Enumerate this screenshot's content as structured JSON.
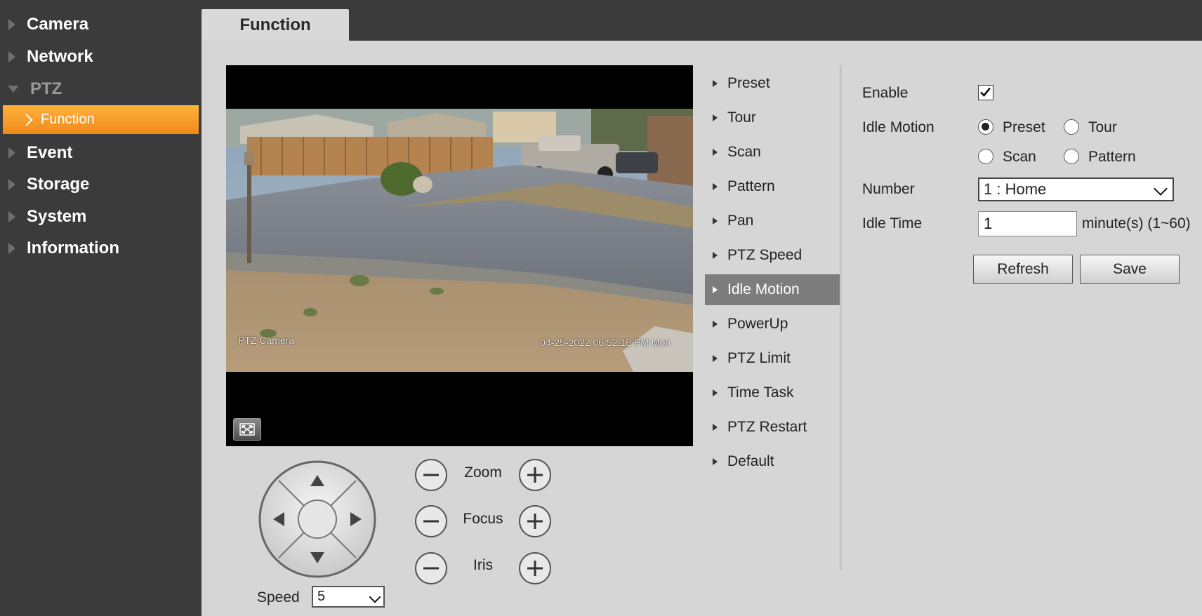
{
  "sidebar": {
    "items": [
      {
        "label": "Camera"
      },
      {
        "label": "Network"
      },
      {
        "label": "PTZ"
      },
      {
        "label": "Event"
      },
      {
        "label": "Storage"
      },
      {
        "label": "System"
      },
      {
        "label": "Information"
      }
    ],
    "sub_active": "Function"
  },
  "tabs": {
    "active": "Function"
  },
  "video": {
    "camera_name": "PTZ Camera",
    "timestamp": "04-25-2022 06:52:18 PM Mon"
  },
  "ptz": {
    "zoom_label": "Zoom",
    "focus_label": "Focus",
    "iris_label": "Iris",
    "speed_label": "Speed",
    "speed_value": "5"
  },
  "menu": {
    "items": [
      "Preset",
      "Tour",
      "Scan",
      "Pattern",
      "Pan",
      "PTZ Speed",
      "Idle Motion",
      "PowerUp",
      "PTZ Limit",
      "Time Task",
      "PTZ Restart",
      "Default"
    ],
    "active": "Idle Motion"
  },
  "form": {
    "enable_label": "Enable",
    "enable_checked": true,
    "idle_motion_label": "Idle Motion",
    "radio_preset": "Preset",
    "radio_tour": "Tour",
    "radio_scan": "Scan",
    "radio_pattern": "Pattern",
    "selected_mode": "Preset",
    "number_label": "Number",
    "number_value": "1 : Home",
    "idle_time_label": "Idle Time",
    "idle_time_value": "1",
    "idle_time_unit": "minute(s) (1~60)",
    "refresh_label": "Refresh",
    "save_label": "Save"
  },
  "colors": {
    "sidebar_bg": "#3b3b3b",
    "active_orange": "#f5a02a",
    "content_bg": "#d6d6d6",
    "menu_active_bg": "#7d7d7d"
  }
}
